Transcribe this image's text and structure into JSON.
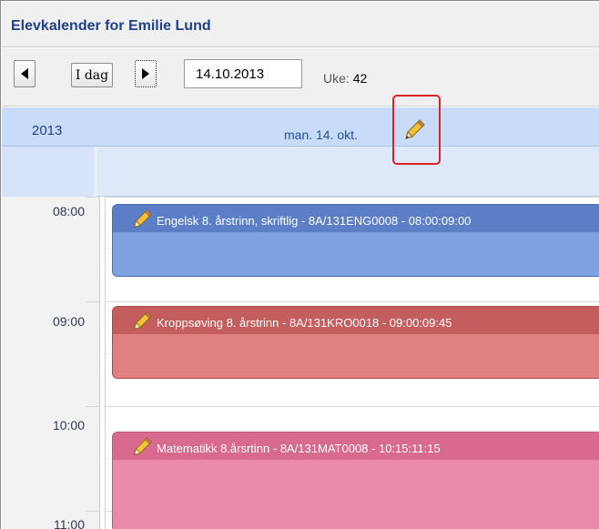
{
  "title": "Elevkalender for Emilie Lund",
  "toolbar": {
    "today_label": "I dag",
    "date_value": "14.10.2013",
    "week_label": "Uke:",
    "week_value": "42"
  },
  "day_header": {
    "year": "2013",
    "day": "man. 14. okt."
  },
  "times": [
    "08:00",
    "09:00",
    "10:00",
    "11:00"
  ],
  "events": [
    {
      "title": "Engelsk 8. årstrinn, skriftlig - 8A/131ENG0008 - 08:00:09:00",
      "color": "#5b7ec6"
    },
    {
      "title": "Kroppsøving 8. årstrinn - 8A/131KRO0018 - 09:00:09:45",
      "color": "#c45e5e"
    },
    {
      "title": "Matematikk 8.årsrtinn - 8A/131MAT0008 - 10:15:11:15",
      "color": "#d86a8e"
    }
  ],
  "icons": {
    "prev": "triangle-left-icon",
    "next": "triangle-right-icon",
    "edit": "pencil-icon"
  },
  "colors": {
    "title": "#1f3f8f",
    "day_header_bg": "#c8dcf8",
    "highlight": "#e0202a"
  }
}
